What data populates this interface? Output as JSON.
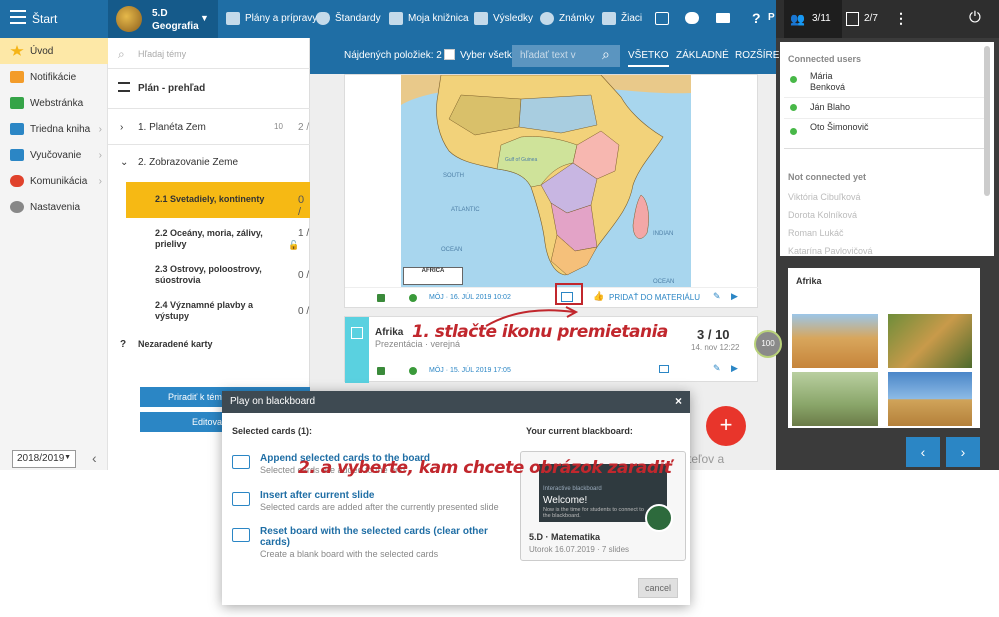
{
  "topbar": {
    "start": "Štart",
    "class_code": "5.D",
    "class_subject": "Geografia",
    "nav": [
      "Plány a prípravy",
      "Štandardy",
      "Moja knižnica",
      "Výsledky",
      "Známky",
      "Žiaci"
    ],
    "help": "?",
    "p_label": "P",
    "users_count": "3/11",
    "boards_count": "2/7"
  },
  "sidebar": {
    "items": [
      "Úvod",
      "Notifikácie",
      "Webstránka",
      "Triedna kniha",
      "Vyučovanie",
      "Komunikácia",
      "Nastavenia"
    ],
    "year": "2018/2019"
  },
  "plan": {
    "search_placeholder": "Hľadaj témy",
    "title": "Plán - prehľad",
    "topic1": "1. Planéta Zem",
    "topic1_n": "10",
    "topic1_m": "2 /",
    "topic2": "2. Zobrazovanie Zeme",
    "sub1": "2.1  Svetadiely, kontinenty",
    "sub1_n": "0 /",
    "sub2": "2.2  Oceány, moria, zálivy, prielivy",
    "sub2_n": "1 /",
    "sub3": "2.3  Ostrovy, poloostrovy, súostrovia",
    "sub3_n": "0 /",
    "sub4": "2.4  Významné plavby a výstupy",
    "sub4_n": "0 /",
    "unassigned_q": "?",
    "unassigned": "Nezaradené karty",
    "assign_btn": "Priradiť k téma",
    "edit_btn": "Editova"
  },
  "toolbar": {
    "found": "Nájdených položiek: 2",
    "select_all": "Vyber všetko",
    "search_placeholder": "hľadať text v",
    "tabs": [
      "VŠETKO",
      "ZÁKLADNÉ",
      "ROZŠÍRE"
    ]
  },
  "map": {
    "labels": [
      "SOUTH",
      "ATLANTIC",
      "OCEAN",
      "INDIAN",
      "OCEAN",
      "Gulf of Guinea",
      "AFRICA"
    ]
  },
  "card1": {
    "meta": "MÔJ · 16. JÚL 2019 10:02",
    "add_material": "PRIDAŤ DO MATERIÁLU"
  },
  "card2": {
    "title": "Afrika",
    "subtitle": "Prezentácia · verejná",
    "count": "3 / 10",
    "date": "14. nov 12:22",
    "meta": "MÔJ · 15. JÚL 2019 17:05",
    "badge": "100"
  },
  "bg_text": "teľov a",
  "fab": "+",
  "connected": {
    "title": "Connected users",
    "users": [
      "Mária Benková",
      "Ján Blaho",
      "Oto Šimonovič"
    ],
    "not_title": "Not connected yet",
    "not_users": [
      "Viktória Cibuľková",
      "Dorota Kolníková",
      "Roman Lukáč",
      "Katarína Pavlovičová"
    ]
  },
  "preview": {
    "title": "Afrika"
  },
  "modal": {
    "title": "Play on blackboard",
    "selected": "Selected cards (1):",
    "current": "Your current blackboard:",
    "opt1_title": "Append selected cards to the board",
    "opt1_desc": "Selected cards are added to the end",
    "opt2_title": "Insert after current slide",
    "opt2_desc": "Selected cards are added after the currently presented slide",
    "opt3_title": "Reset board with the selected cards (clear other cards)",
    "opt3_desc": "Create a blank board with the selected cards",
    "board_header": "Interactive blackboard",
    "board_welcome": "Welcome!",
    "board_text": "Now is the time for students to connect to the blackboard.",
    "board_class": "5.D · Matematika",
    "board_info": "Utorok 16.07.2019 · 7 slides",
    "cancel": "cancel"
  },
  "annotations": {
    "a1": "1. stlačte ikonu premietania",
    "a2": "2. a vyberte, kam chcete obrázok zaradiť"
  }
}
